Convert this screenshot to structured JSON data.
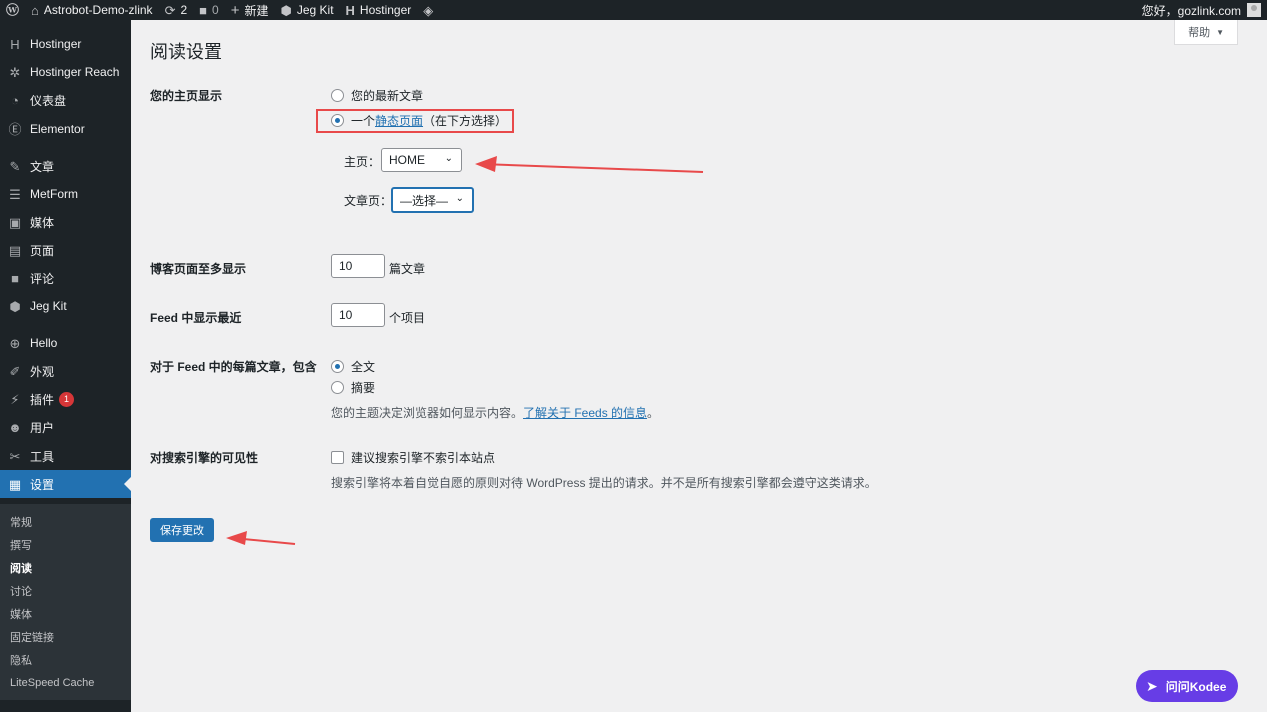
{
  "adminbar": {
    "site_name": "Astrobot-Demo-zlink",
    "updates_count": "2",
    "comments_count": "0",
    "new_label": "新建",
    "jegkit_label": "Jeg Kit",
    "hostinger_label": "Hostinger",
    "greeting": "您好，gozlink.com"
  },
  "sidebar": {
    "items": [
      {
        "label": "Hostinger",
        "icon": "hostinger-icon"
      },
      {
        "label": "Hostinger Reach",
        "icon": "reach-icon"
      },
      {
        "label": "仪表盘",
        "icon": "dashboard-icon"
      },
      {
        "label": "Elementor",
        "icon": "elementor-icon"
      },
      {
        "label": "文章",
        "icon": "pin-icon"
      },
      {
        "label": "MetForm",
        "icon": "form-icon"
      },
      {
        "label": "媒体",
        "icon": "media-icon"
      },
      {
        "label": "页面",
        "icon": "page-icon"
      },
      {
        "label": "评论",
        "icon": "comment-icon"
      },
      {
        "label": "Jeg Kit",
        "icon": "jegkit-icon"
      },
      {
        "label": "Hello",
        "icon": "hello-icon"
      },
      {
        "label": "外观",
        "icon": "appearance-icon"
      },
      {
        "label": "插件",
        "icon": "plugin-icon",
        "badge": "1"
      },
      {
        "label": "用户",
        "icon": "user-icon"
      },
      {
        "label": "工具",
        "icon": "wrench-icon"
      },
      {
        "label": "设置",
        "icon": "settings-icon"
      }
    ],
    "submenu": [
      "常规",
      "撰写",
      "阅读",
      "讨论",
      "媒体",
      "固定链接",
      "隐私",
      "LiteSpeed Cache"
    ]
  },
  "page": {
    "title": "阅读设置",
    "help_label": "帮助",
    "homepage_label": "您的主页显示",
    "radio_latest": "您的最新文章",
    "radio_static_prefix": "一个",
    "radio_static_link": "静态页面",
    "radio_static_suffix": "（在下方选择）",
    "front_page_label": "主页：",
    "front_page_value": "HOME",
    "posts_page_label": "文章页：",
    "posts_page_value": "—选择—",
    "blog_pages_label": "博客页面至多显示",
    "blog_pages_value": "10",
    "blog_pages_unit": "篇文章",
    "feed_label": "Feed 中显示最近",
    "feed_value": "10",
    "feed_unit": "个项目",
    "feed_content_label": "对于 Feed 中的每篇文章，包含",
    "feed_full": "全文",
    "feed_summary": "摘要",
    "feed_desc_prefix": "您的主题决定浏览器如何显示内容。",
    "feed_desc_link": "了解关于 Feeds 的信息",
    "feed_desc_suffix": "。",
    "search_label": "对搜索引擎的可见性",
    "search_checkbox": "建议搜索引擎不索引本站点",
    "search_desc": "搜索引擎将本着自觉自愿的原则对待 WordPress 提出的请求。并不是所有搜索引擎都会遵守这类请求。",
    "save_button": "保存更改",
    "kodee_label": "问问Kodee"
  },
  "colors": {
    "accent": "#2271b1",
    "highlight": "#e8494a",
    "kodee": "#673de6"
  }
}
